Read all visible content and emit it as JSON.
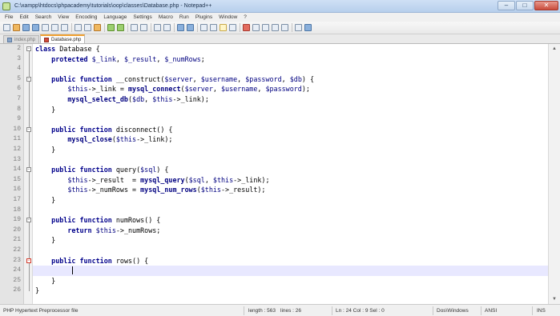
{
  "window": {
    "title": "C:\\xampp\\htdocs\\phpacademy\\tutorials\\oop\\classes\\Database.php - Notepad++",
    "controls": {
      "minimize": "–",
      "maximize": "□",
      "close": "✕"
    }
  },
  "menu": [
    "File",
    "Edit",
    "Search",
    "View",
    "Encoding",
    "Language",
    "Settings",
    "Macro",
    "Run",
    "Plugins",
    "Window",
    "?"
  ],
  "tabs": [
    {
      "label": "index.php",
      "active": false
    },
    {
      "label": "Database.php",
      "active": true
    }
  ],
  "editor": {
    "lines": [
      {
        "num": "2",
        "text": "class Database {"
      },
      {
        "num": "3",
        "text": "    protected $_link, $_result, $_numRows;"
      },
      {
        "num": "4",
        "text": ""
      },
      {
        "num": "5",
        "text": "    public function __construct($server, $username, $password, $db) {"
      },
      {
        "num": "6",
        "text": "        $this->_link = mysql_connect($server, $username, $password);"
      },
      {
        "num": "7",
        "text": "        mysql_select_db($db, $this->_link);"
      },
      {
        "num": "8",
        "text": "    }"
      },
      {
        "num": "9",
        "text": ""
      },
      {
        "num": "10",
        "text": "    public function disconnect() {"
      },
      {
        "num": "11",
        "text": "        mysql_close($this->_link);"
      },
      {
        "num": "12",
        "text": "    }"
      },
      {
        "num": "13",
        "text": ""
      },
      {
        "num": "14",
        "text": "    public function query($sql) {"
      },
      {
        "num": "15",
        "text": "        $this->_result  = mysql_query($sql, $this->_link);"
      },
      {
        "num": "16",
        "text": "        $this->_numRows = mysql_num_rows($this->_result);"
      },
      {
        "num": "17",
        "text": "    }"
      },
      {
        "num": "18",
        "text": ""
      },
      {
        "num": "19",
        "text": "    public function numRows() {"
      },
      {
        "num": "20",
        "text": "        return $this->_numRows;"
      },
      {
        "num": "21",
        "text": "    }"
      },
      {
        "num": "22",
        "text": ""
      },
      {
        "num": "23",
        "text": "    public function rows() {"
      },
      {
        "num": "24",
        "text": ""
      },
      {
        "num": "25",
        "text": "    }"
      },
      {
        "num": "26",
        "text": "}"
      }
    ],
    "current_line": "24"
  },
  "status": {
    "file_type": "PHP Hypertext Preprocessor file",
    "length": "length : 563",
    "lines": "lines : 26",
    "position": "Ln : 24    Col : 9    Sel : 0",
    "eol": "Dos\\Windows",
    "encoding": "ANSI",
    "mode": "INS"
  },
  "colors": {
    "keyword": "#00008b",
    "current_line": "#e8e8ff",
    "gutter": "#e4e4e4"
  }
}
